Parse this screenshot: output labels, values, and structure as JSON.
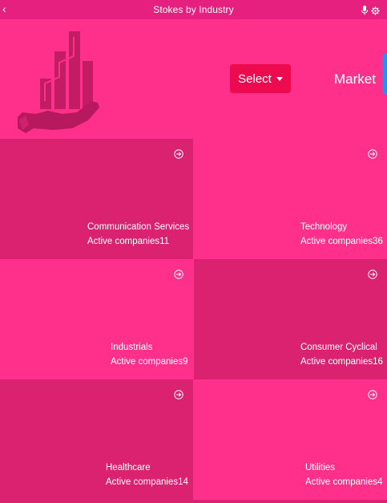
{
  "window": {
    "title": "Stokes by Industry",
    "back_icon": "chevron-left-icon",
    "mic_icon": "microphone-icon",
    "settings_icon": "gear-icon"
  },
  "header": {
    "select_label": "Select",
    "market_label": "Market",
    "colors": {
      "background": "#ff2f8c",
      "select_button": "#ee0a4f",
      "logo": "#b7195e",
      "edge_tab": "#2f8df0"
    }
  },
  "industries": [
    {
      "name": "Communication Services",
      "count_label": "Active companies11"
    },
    {
      "name": "Technology",
      "count_label": "Active companies36"
    },
    {
      "name": "Industrials",
      "count_label": "Active companies9"
    },
    {
      "name": "Consumer Cyclical",
      "count_label": "Active companies16"
    },
    {
      "name": "Healthcare",
      "count_label": "Active companies14"
    },
    {
      "name": "Utilities",
      "count_label": "Active companies4"
    }
  ],
  "card_colors": {
    "dark": "#db2270",
    "light": "#ff2f8c"
  }
}
